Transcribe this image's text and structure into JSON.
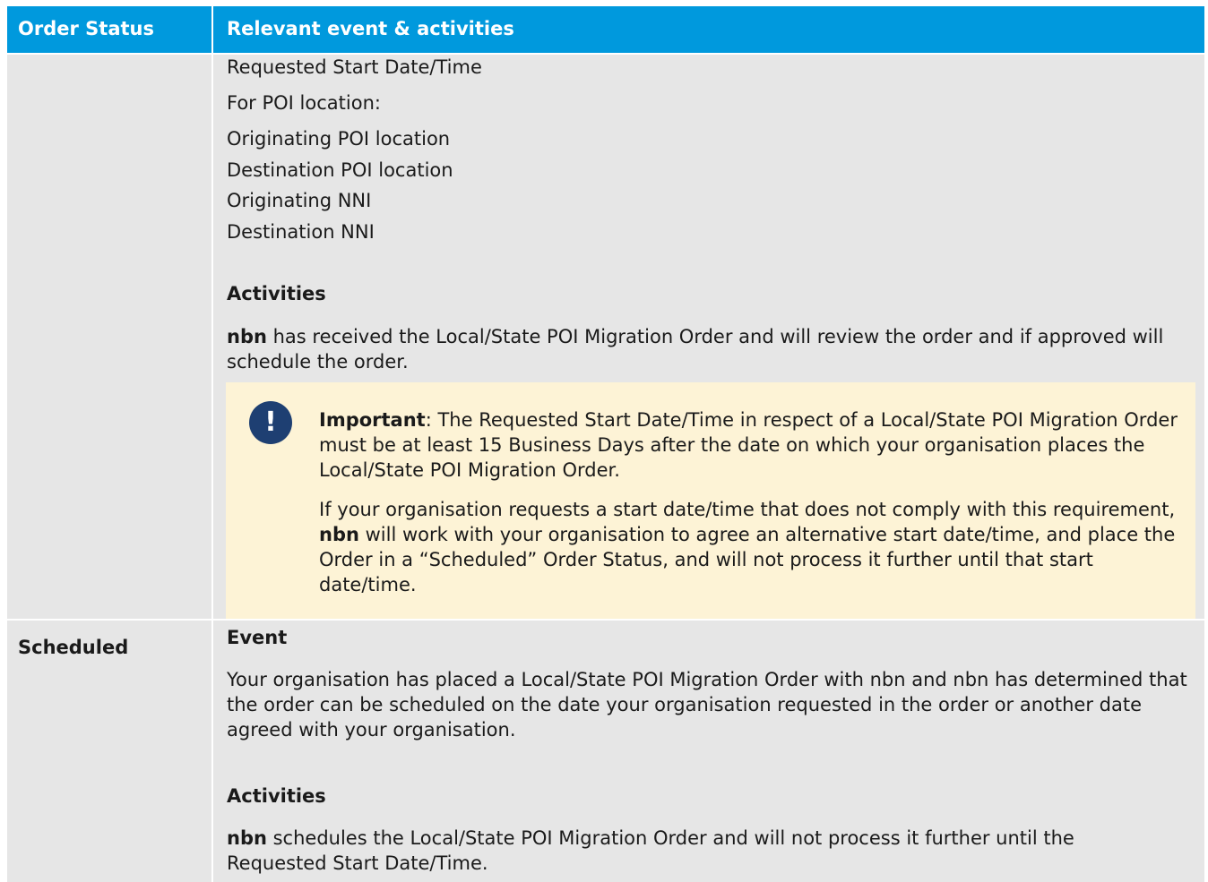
{
  "header": {
    "col1": "Order Status",
    "col2": "Relevant event & activities"
  },
  "row1": {
    "lines": [
      "Requested Start Date/Time",
      "For POI location:",
      "Originating POI location",
      "Destination POI location",
      "Originating NNI",
      "Destination NNI"
    ],
    "activities_heading": "Activities",
    "activities_bold": "nbn",
    "activities_text": " has received the Local/State POI Migration Order and will review the order and if approved will schedule the order.",
    "callout": {
      "icon": "exclamation-icon",
      "icon_glyph": "!",
      "important_label": "Important",
      "important_text": ": The Requested Start Date/Time in respect of a Local/State POI Migration Order must be at least 15 Business Days after the date on which your organisation places the Local/State POI Migration Order.",
      "para2_a": "If your organisation requests a start date/time that does not comply with this requirement, ",
      "para2_bold": "nbn",
      "para2_b": " will work with your organisation to agree an alternative start date/time, and place the Order in a “Scheduled” Order Status, and will not process it further until that start date/time.",
      "bg_color": "#fdf3d6",
      "icon_color": "#1e3f72"
    }
  },
  "row2": {
    "status": "Scheduled",
    "event_heading": "Event",
    "event_text": "Your organisation has placed a Local/State POI Migration Order with nbn and nbn has determined that the order can be scheduled on the date your organisation requested in the order or another date agreed with your organisation.",
    "activities_heading": "Activities",
    "activities_bold": "nbn",
    "activities_text": " schedules the Local/State POI Migration Order and will not process it further until the Requested Start Date/Time."
  },
  "colors": {
    "header_bg": "#0099dd",
    "cell_bg": "#e6e6e6"
  }
}
